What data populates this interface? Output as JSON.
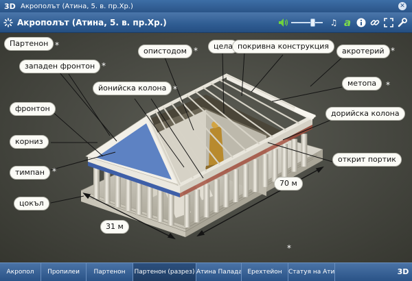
{
  "window": {
    "logo": "3D",
    "title": "Акрополът (Атина, 5. в. пр.Хр.)"
  },
  "header": {
    "heading": "Акрополът (Атина, 5. в. пр.Хр.)",
    "volume_level_percent": 72,
    "tools": {
      "music": "♫",
      "green": "a",
      "info": "i"
    }
  },
  "labels": {
    "parthenon": "Партенон",
    "west_pediment": "западен фронтон",
    "opisthodomos": "опистодом",
    "cella": "цела",
    "roof": "покривна конструкция",
    "acroterion": "акротерий",
    "ionic_column": "йонийска колона",
    "metope": "метопа",
    "pediment": "фронтон",
    "doric_column": "дорийска колона",
    "cornice": "корниз",
    "open_portico": "открит портик",
    "tympanum": "тимпан",
    "length": "70 м",
    "plinth": "цокъл",
    "width": "31 м"
  },
  "star": "*",
  "nav": {
    "tabs": [
      "Акропол",
      "Пропилеи",
      "Партенон",
      "Партенон (разрез)",
      "Атина Палада",
      "Ерехтейон",
      "Статуя на Атина"
    ],
    "active_index": 3,
    "brand": "3D"
  },
  "colors": {
    "accent": "#2f5c92",
    "active_tab": "#1e3c63",
    "label_bg": "#fbfbf6"
  }
}
